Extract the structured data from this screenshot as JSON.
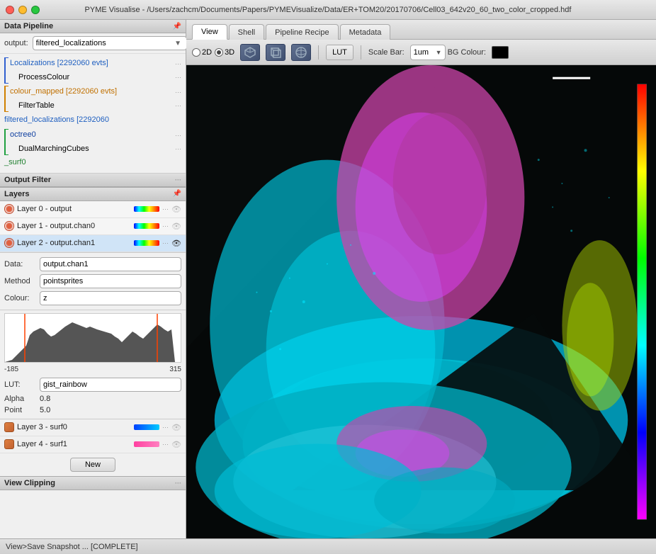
{
  "titleBar": {
    "title": "PYME Visualise - /Users/zachcm/Documents/Papers/PYMEVisualize/Data/ER+TOM20/20170706/Cell03_642v20_60_two_color_cropped.hdf"
  },
  "tabs": [
    {
      "label": "View",
      "active": true
    },
    {
      "label": "Shell",
      "active": false
    },
    {
      "label": "Pipeline Recipe",
      "active": false
    },
    {
      "label": "Metadata",
      "active": false
    }
  ],
  "toolbar": {
    "mode2d": "2D",
    "mode3d": "3D",
    "lutButton": "LUT",
    "scaleBarLabel": "Scale Bar:",
    "scaleBarValue": "1um",
    "bgColourLabel": "BG Colour:"
  },
  "dataPipeline": {
    "header": "Data Pipeline",
    "outputLabel": "output:",
    "outputValue": "filtered_localizations",
    "treeItems": [
      {
        "label": "Localizations [2292060 evts]",
        "level": 0,
        "color": "blue"
      },
      {
        "label": "ProcessColour",
        "level": 1,
        "color": "black"
      },
      {
        "label": "colour_mapped [2292060 evts]",
        "level": 0,
        "color": "orange"
      },
      {
        "label": "FilterTable",
        "level": 1,
        "color": "black"
      },
      {
        "label": "filtered_localizations [2292060",
        "level": 0,
        "color": "blue"
      },
      {
        "label": "octree0",
        "level": 0,
        "color": "darkblue"
      },
      {
        "label": "DualMarchingCubes",
        "level": 1,
        "color": "black"
      },
      {
        "label": "_surf0",
        "level": 0,
        "color": "green"
      }
    ]
  },
  "outputFilter": {
    "header": "Output Filter"
  },
  "layers": {
    "header": "Layers",
    "items": [
      {
        "name": "Layer 0 - output",
        "colormapClass": "cm-rainbow",
        "visible": false,
        "selected": false
      },
      {
        "name": "Layer 1 - output.chan0",
        "colormapClass": "cm-rainbow",
        "visible": false,
        "selected": false
      },
      {
        "name": "Layer 2 - output.chan1",
        "colormapClass": "cm-rainbow",
        "visible": true,
        "selected": true
      }
    ],
    "bottomItems": [
      {
        "name": "Layer 3 - surf0",
        "colormapClass": "cm-blue",
        "visible": false,
        "selected": false
      },
      {
        "name": "Layer 4 - surf1",
        "colormapClass": "cm-pink",
        "visible": false,
        "selected": false
      }
    ],
    "details": {
      "dataLabel": "Data:",
      "dataValue": "output.chan1",
      "methodLabel": "Method",
      "methodValue": "pointsprites",
      "colourLabel": "Colour:",
      "colourValue": "z",
      "histMin": "-185",
      "histMax": "315",
      "lutLabel": "LUT:",
      "lutValue": "gist_rainbow",
      "alphaLabel": "Alpha",
      "alphaValue": "0.8",
      "pointLabel": "Point",
      "pointValue": "5.0"
    }
  },
  "buttons": {
    "new": "New"
  },
  "viewClipping": {
    "header": "View Clipping"
  },
  "statusBar": {
    "text": "View>Save Snapshot ... [COMPLETE]"
  }
}
